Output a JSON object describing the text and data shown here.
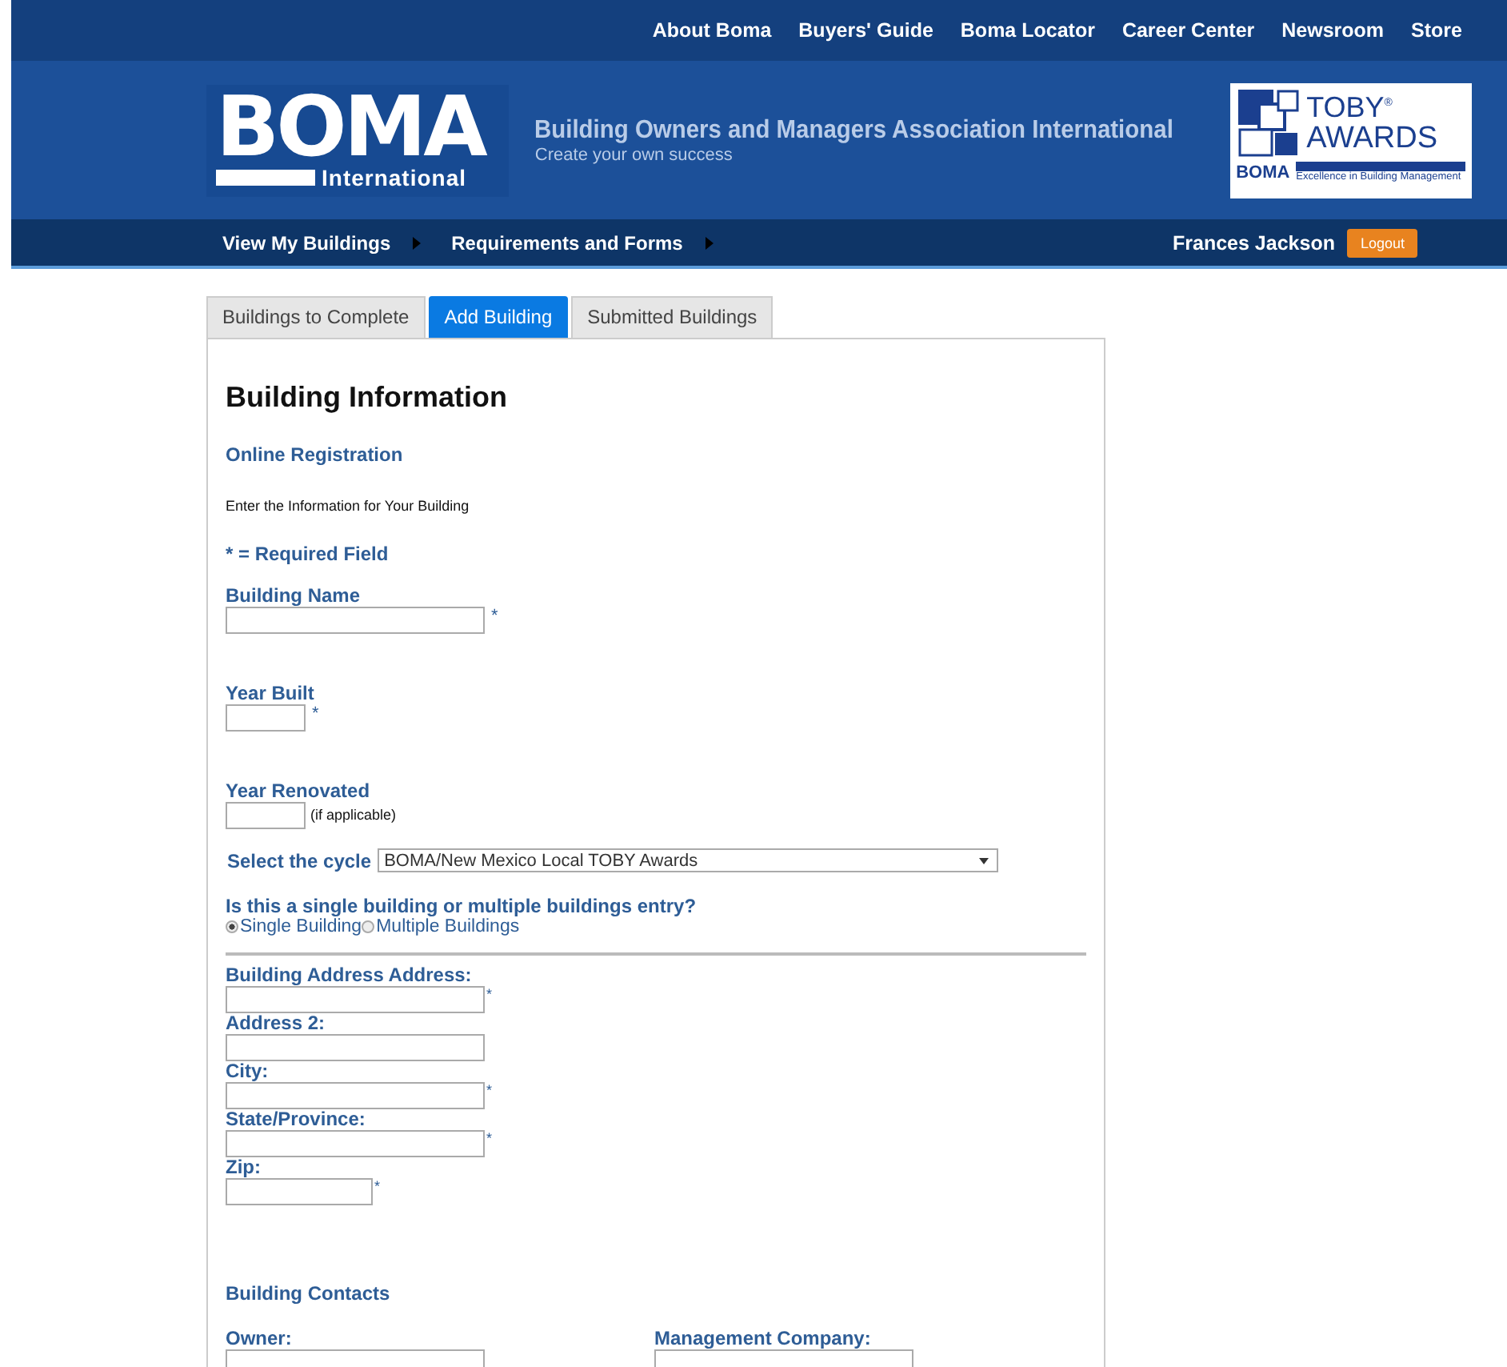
{
  "top_links": [
    "About Boma",
    "Buyers' Guide",
    "Boma Locator",
    "Career Center",
    "Newsroom",
    "Store"
  ],
  "header": {
    "logo_main": "BOMA",
    "logo_sub": "International",
    "org_name": "Building Owners and Managers Association International",
    "tagline": "Create your own success",
    "toby": {
      "title": "TOBY",
      "reg": "®",
      "awards": "AWARDS",
      "boma": "BOMA",
      "caption": "Excellence in Building Management"
    }
  },
  "nav": {
    "items": [
      "View My Buildings",
      "Requirements and Forms"
    ],
    "user": "Frances Jackson",
    "logout": "Logout"
  },
  "tabs": [
    {
      "label": "Buildings to Complete",
      "selected": false
    },
    {
      "label": "Add Building",
      "selected": true
    },
    {
      "label": "Submitted Buildings",
      "selected": false
    }
  ],
  "form": {
    "title": "Building Information",
    "subtitle": "Online Registration",
    "intro": "Enter the Information for Your Building",
    "required_note": "* = Required Field",
    "basic_fields": [
      {
        "label": "Building Name",
        "kind": "text",
        "mark": "*"
      },
      {
        "label": "Year Built",
        "kind": "year",
        "mark": "*"
      },
      {
        "label": "Year Renovated",
        "kind": "year",
        "note": "(if applicable)"
      }
    ],
    "cycle": {
      "label": "Select the cycle",
      "value": "BOMA/New Mexico Local TOBY Awards"
    },
    "entry_type": {
      "question": "Is this a single building or multiple buildings entry?",
      "options": [
        {
          "label": "Single Building",
          "selected": true
        },
        {
          "label": "Multiple Buildings",
          "selected": false
        }
      ]
    },
    "address_fields": [
      {
        "label": "Building Address Address:",
        "kind": "text",
        "mark": "*"
      },
      {
        "label": "Address 2:",
        "kind": "text"
      },
      {
        "label": "City:",
        "kind": "text",
        "mark": "*"
      },
      {
        "label": "State/Province:",
        "kind": "text",
        "mark": "*"
      },
      {
        "label": "Zip:",
        "kind": "zip",
        "mark": "*"
      }
    ],
    "contacts": {
      "title": "Building Contacts",
      "fields": [
        {
          "label": "Owner:"
        },
        {
          "label": "Management Company:"
        }
      ]
    }
  }
}
